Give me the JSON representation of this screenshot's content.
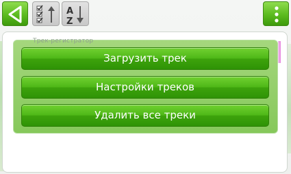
{
  "dialog": {
    "title": "Трек-регистратор",
    "buttons": [
      {
        "label": "Загрузить трек"
      },
      {
        "label": "Настройки треков"
      },
      {
        "label": "Удалить все треки"
      }
    ]
  },
  "toolbar": {
    "sort_icon_letters": "AZ"
  },
  "colors": {
    "accent_green": "#4fb818",
    "dialog_green": "#96cf6c",
    "scroll_indicator": "#e78fe0"
  }
}
